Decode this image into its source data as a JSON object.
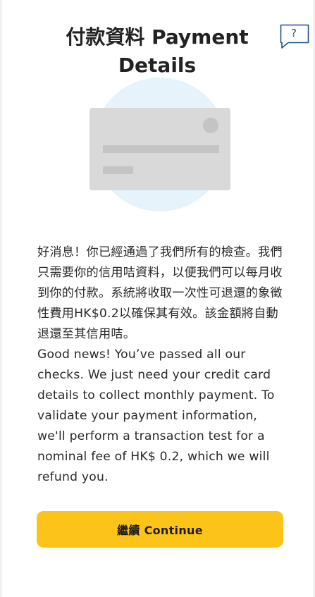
{
  "header": {
    "title": "付款資料 Payment Details",
    "help_label": "?"
  },
  "illustration": {
    "icon": "credit-card-icon",
    "circle_color": "#e6f3fa",
    "card_color": "#d9d9d9",
    "detail_color": "#c4c4c4"
  },
  "body": {
    "message_zh": "好消息！你已經通過了我們所有的檢查。我們只需要你的信用咭資料，以便我們可以每月收到你的付款。系統將收取一次性可退還的象徵性費用HK$0.2以確保其有效。該金額將自動退還至其信用咭。",
    "message_en": "Good news! You’ve passed all our checks. We just need your credit card details to collect monthly payment. To validate your payment information, we'll perform a transaction test for a nominal fee of HK$ 0.2, which we will refund you."
  },
  "actions": {
    "continue_label": "繼續 Continue"
  },
  "colors": {
    "accent": "#fcc419",
    "help_icon": "#1f4f8f"
  }
}
